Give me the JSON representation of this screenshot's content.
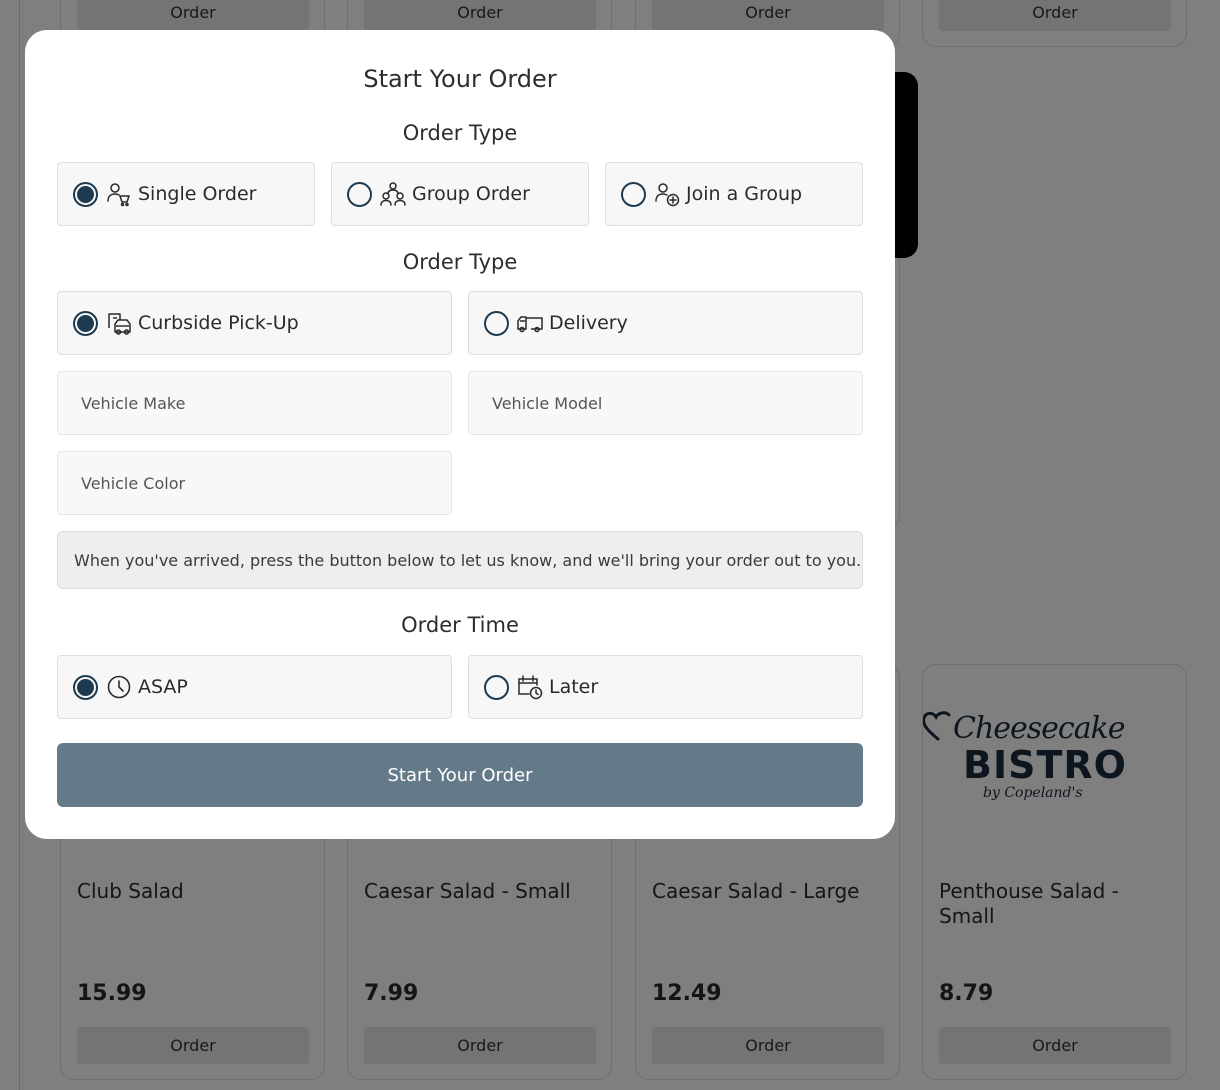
{
  "background": {
    "top_buttons": [
      "Order",
      "Order",
      "Order",
      "Order"
    ],
    "logo": {
      "script_text": "Cheesecake",
      "main_text": "BISTRO",
      "by_text": "by Copeland's",
      "color": "#1b2c3f"
    },
    "items": [
      {
        "name": "Club Salad",
        "price": "15.99",
        "button": "Order"
      },
      {
        "name": "Caesar Salad - Small",
        "price": "7.99",
        "button": "Order"
      },
      {
        "name": "Caesar Salad - Large",
        "price": "12.49",
        "button": "Order"
      },
      {
        "name": "Penthouse Salad - Small",
        "price": "8.79",
        "button": "Order"
      }
    ]
  },
  "modal": {
    "title": "Start Your Order",
    "order_type_heading": "Order Type",
    "order_type_options": [
      {
        "label": "Single Order",
        "icon": "single-person-icon",
        "selected": true
      },
      {
        "label": "Group Order",
        "icon": "group-icon",
        "selected": false
      },
      {
        "label": "Join a Group",
        "icon": "add-person-icon",
        "selected": false
      }
    ],
    "fulfillment_heading": "Order Type",
    "fulfillment_options": [
      {
        "label": "Curbside Pick-Up",
        "icon": "car-pickup-icon",
        "selected": true
      },
      {
        "label": "Delivery",
        "icon": "delivery-truck-icon",
        "selected": false
      }
    ],
    "vehicle_make_placeholder": "Vehicle Make",
    "vehicle_model_placeholder": "Vehicle Model",
    "vehicle_color_placeholder": "Vehicle Color",
    "notice": "When you've arrived, press the button below to let us know, and we'll bring your order out to you.",
    "order_time_heading": "Order Time",
    "order_time_options": [
      {
        "label": "ASAP",
        "icon": "clock-icon",
        "selected": true
      },
      {
        "label": "Later",
        "icon": "calendar-clock-icon",
        "selected": false
      }
    ],
    "submit_label": "Start Your Order",
    "accent_color": "#1d3a50",
    "submit_color": "#657a88"
  }
}
